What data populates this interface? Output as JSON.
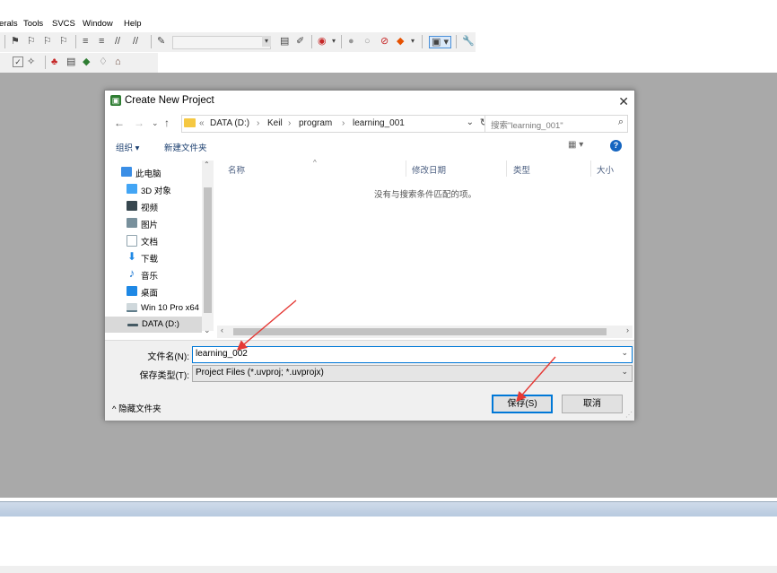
{
  "menubar": {
    "items": [
      "erals",
      "Tools",
      "SVCS",
      "Window",
      "Help"
    ]
  },
  "dialog": {
    "title": "Create New Project",
    "close_glyph": "✕",
    "breadcrumb": [
      "«",
      "DATA (D:)",
      "›",
      "Keil",
      "›",
      "program",
      "›",
      "learning_001"
    ],
    "search_placeholder": "搜索\"learning_001\"",
    "organize_label": "组织 ▾",
    "new_folder_label": "新建文件夹",
    "help_glyph": "?",
    "nav_items": [
      {
        "label": "此电脑",
        "icon": "pc-icon",
        "color": "#3a8ee6"
      },
      {
        "label": "3D 对象",
        "icon": "3d-objects-icon",
        "color": "#42a5f5"
      },
      {
        "label": "视频",
        "icon": "video-icon",
        "color": "#37474f"
      },
      {
        "label": "图片",
        "icon": "pictures-icon",
        "color": "#78909c"
      },
      {
        "label": "文档",
        "icon": "documents-icon",
        "color": "#90a4ae"
      },
      {
        "label": "下载",
        "icon": "download-icon",
        "color": "#1e88e5"
      },
      {
        "label": "音乐",
        "icon": "music-icon",
        "color": "#1976d2"
      },
      {
        "label": "桌面",
        "icon": "desktop-icon",
        "color": "#1e88e5"
      },
      {
        "label": "Win 10 Pro x64",
        "icon": "drive-icon",
        "color": "#607d8b"
      },
      {
        "label": "DATA (D:)",
        "icon": "drive-icon",
        "color": "#455a64"
      }
    ],
    "columns": [
      "名称",
      "修改日期",
      "类型",
      "大小"
    ],
    "empty_message": "没有与搜索条件匹配的项。",
    "filename_label": "文件名(N):",
    "filename_value": "learning_002",
    "filetype_label": "保存类型(T):",
    "filetype_value": "Project Files (*.uvproj; *.uvprojx)",
    "hide_folders_label": "^ 隐藏文件夹",
    "save_label": "保存(S)",
    "cancel_label": "取消"
  },
  "colors": {
    "workspace": "#a9a9a9",
    "accent": "#0078d7",
    "arrow": "#e53935"
  }
}
